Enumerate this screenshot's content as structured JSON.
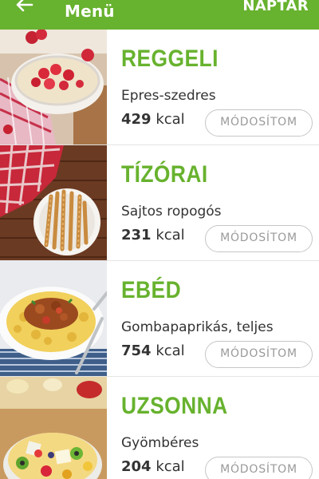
{
  "appbar": {
    "back_icon": "arrow-left-icon",
    "title": "Menü",
    "action_label": "NAPTÁR",
    "accent_color": "#67b22e"
  },
  "meals": [
    {
      "name": "REGGELI",
      "description": "Epres-szedres",
      "kcal_value": "429",
      "kcal_unit": "kcal",
      "button_label": "MÓDOSÍTOM"
    },
    {
      "name": "TÍZÓRAI",
      "description": "Sajtos ropogós",
      "kcal_value": "231",
      "kcal_unit": "kcal",
      "button_label": "MÓDOSÍTOM"
    },
    {
      "name": "EBÉD",
      "description": "Gombapaprikás, teljes",
      "kcal_value": "754",
      "kcal_unit": "kcal",
      "button_label": "MÓDOSÍTOM"
    },
    {
      "name": "UZSONNA",
      "description": "Gyömbéres",
      "kcal_value": "204",
      "kcal_unit": "kcal",
      "button_label": "MÓDOSÍTOM"
    }
  ]
}
